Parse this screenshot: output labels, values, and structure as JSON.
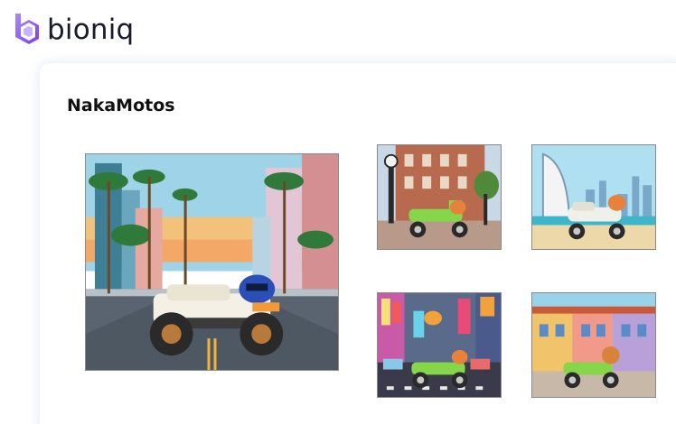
{
  "brand": {
    "name": "bioniq",
    "color": "#8b5cf6"
  },
  "collection": {
    "title": "NakaMotos",
    "images": [
      {
        "subject": "white motorcycle on palm-lined city street at sunset"
      },
      {
        "subject": "green scooter in front of brick building with street clock"
      },
      {
        "subject": "white scooter on beach with sail-shaped skyscraper"
      },
      {
        "subject": "green scooter on neon-signed city street"
      },
      {
        "subject": "green scooter in front of colorful shophouses"
      }
    ]
  }
}
